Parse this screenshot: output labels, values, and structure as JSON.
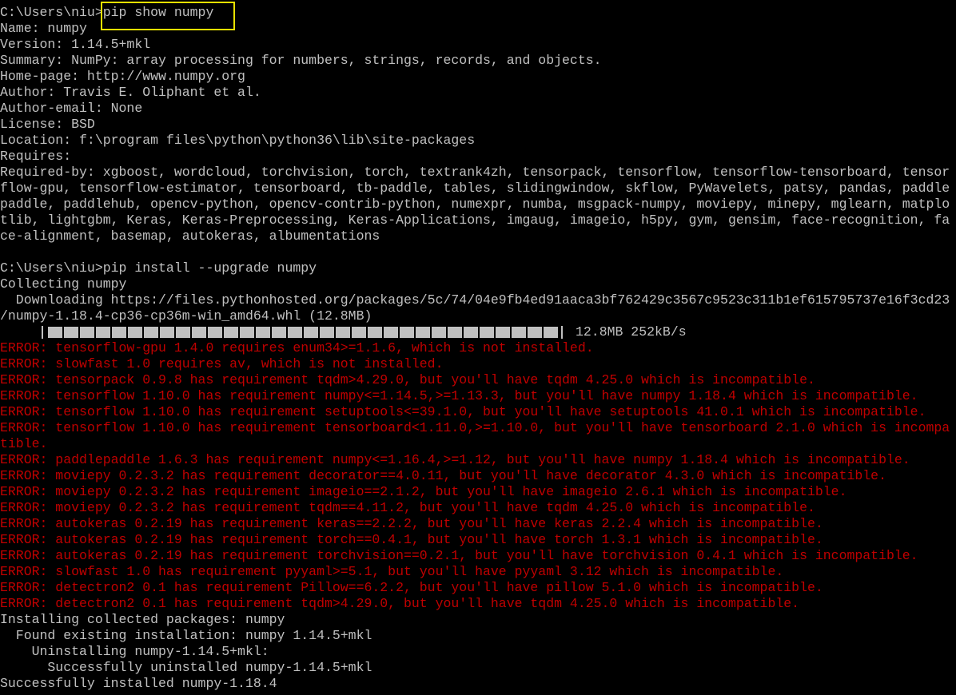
{
  "colors": {
    "background": "#000000",
    "text": "#c0c0c0",
    "error": "#c00000",
    "highlight": "#e8e000"
  },
  "progress": {
    "fraction": 1.0,
    "info": "12.8MB 252kB/s"
  },
  "lines": [
    {
      "text": "C:\\Users\\niu>pip show numpy",
      "kind": "normal"
    },
    {
      "text": "Name: numpy",
      "kind": "normal"
    },
    {
      "text": "Version: 1.14.5+mkl",
      "kind": "normal"
    },
    {
      "text": "Summary: NumPy: array processing for numbers, strings, records, and objects.",
      "kind": "normal"
    },
    {
      "text": "Home-page: http://www.numpy.org",
      "kind": "normal"
    },
    {
      "text": "Author: Travis E. Oliphant et al.",
      "kind": "normal"
    },
    {
      "text": "Author-email: None",
      "kind": "normal"
    },
    {
      "text": "License: BSD",
      "kind": "normal"
    },
    {
      "text": "Location: f:\\program files\\python\\python36\\lib\\site-packages",
      "kind": "normal"
    },
    {
      "text": "Requires:",
      "kind": "normal"
    },
    {
      "text": "Required-by: xgboost, wordcloud, torchvision, torch, textrank4zh, tensorpack, tensorflow, tensorflow-tensorboard, tensor",
      "kind": "normal"
    },
    {
      "text": "flow-gpu, tensorflow-estimator, tensorboard, tb-paddle, tables, slidingwindow, skflow, PyWavelets, patsy, pandas, paddle",
      "kind": "normal"
    },
    {
      "text": "paddle, paddlehub, opencv-python, opencv-contrib-python, numexpr, numba, msgpack-numpy, moviepy, minepy, mglearn, matplo",
      "kind": "normal"
    },
    {
      "text": "tlib, lightgbm, Keras, Keras-Preprocessing, Keras-Applications, imgaug, imageio, h5py, gym, gensim, face-recognition, fa",
      "kind": "normal"
    },
    {
      "text": "ce-alignment, basemap, autokeras, albumentations",
      "kind": "normal"
    },
    {
      "text": "",
      "kind": "normal"
    },
    {
      "text": "C:\\Users\\niu>pip install --upgrade numpy",
      "kind": "normal"
    },
    {
      "text": "Collecting numpy",
      "kind": "normal"
    },
    {
      "text": "  Downloading https://files.pythonhosted.org/packages/5c/74/04e9fb4ed91aaca3bf762429c3567c9523c311b1ef615795737e16f3cd23",
      "kind": "normal"
    },
    {
      "text": "/numpy-1.18.4-cp36-cp36m-win_amd64.whl (12.8MB)",
      "kind": "normal"
    },
    {
      "text": "",
      "kind": "progress"
    },
    {
      "text": "ERROR: tensorflow-gpu 1.4.0 requires enum34>=1.1.6, which is not installed.",
      "kind": "error"
    },
    {
      "text": "ERROR: slowfast 1.0 requires av, which is not installed.",
      "kind": "error"
    },
    {
      "text": "ERROR: tensorpack 0.9.8 has requirement tqdm>4.29.0, but you'll have tqdm 4.25.0 which is incompatible.",
      "kind": "error"
    },
    {
      "text": "ERROR: tensorflow 1.10.0 has requirement numpy<=1.14.5,>=1.13.3, but you'll have numpy 1.18.4 which is incompatible.",
      "kind": "error"
    },
    {
      "text": "ERROR: tensorflow 1.10.0 has requirement setuptools<=39.1.0, but you'll have setuptools 41.0.1 which is incompatible.",
      "kind": "error"
    },
    {
      "text": "ERROR: tensorflow 1.10.0 has requirement tensorboard<1.11.0,>=1.10.0, but you'll have tensorboard 2.1.0 which is incompa",
      "kind": "error"
    },
    {
      "text": "tible.",
      "kind": "error"
    },
    {
      "text": "ERROR: paddlepaddle 1.6.3 has requirement numpy<=1.16.4,>=1.12, but you'll have numpy 1.18.4 which is incompatible.",
      "kind": "error"
    },
    {
      "text": "ERROR: moviepy 0.2.3.2 has requirement decorator==4.0.11, but you'll have decorator 4.3.0 which is incompatible.",
      "kind": "error"
    },
    {
      "text": "ERROR: moviepy 0.2.3.2 has requirement imageio==2.1.2, but you'll have imageio 2.6.1 which is incompatible.",
      "kind": "error"
    },
    {
      "text": "ERROR: moviepy 0.2.3.2 has requirement tqdm==4.11.2, but you'll have tqdm 4.25.0 which is incompatible.",
      "kind": "error"
    },
    {
      "text": "ERROR: autokeras 0.2.19 has requirement keras==2.2.2, but you'll have keras 2.2.4 which is incompatible.",
      "kind": "error"
    },
    {
      "text": "ERROR: autokeras 0.2.19 has requirement torch==0.4.1, but you'll have torch 1.3.1 which is incompatible.",
      "kind": "error"
    },
    {
      "text": "ERROR: autokeras 0.2.19 has requirement torchvision==0.2.1, but you'll have torchvision 0.4.1 which is incompatible.",
      "kind": "error"
    },
    {
      "text": "ERROR: slowfast 1.0 has requirement pyyaml>=5.1, but you'll have pyyaml 3.12 which is incompatible.",
      "kind": "error"
    },
    {
      "text": "ERROR: detectron2 0.1 has requirement Pillow==6.2.2, but you'll have pillow 5.1.0 which is incompatible.",
      "kind": "error"
    },
    {
      "text": "ERROR: detectron2 0.1 has requirement tqdm>4.29.0, but you'll have tqdm 4.25.0 which is incompatible.",
      "kind": "error"
    },
    {
      "text": "Installing collected packages: numpy",
      "kind": "normal"
    },
    {
      "text": "  Found existing installation: numpy 1.14.5+mkl",
      "kind": "normal"
    },
    {
      "text": "    Uninstalling numpy-1.14.5+mkl:",
      "kind": "normal"
    },
    {
      "text": "      Successfully uninstalled numpy-1.14.5+mkl",
      "kind": "normal"
    },
    {
      "text": "Successfully installed numpy-1.18.4",
      "kind": "normal"
    }
  ]
}
